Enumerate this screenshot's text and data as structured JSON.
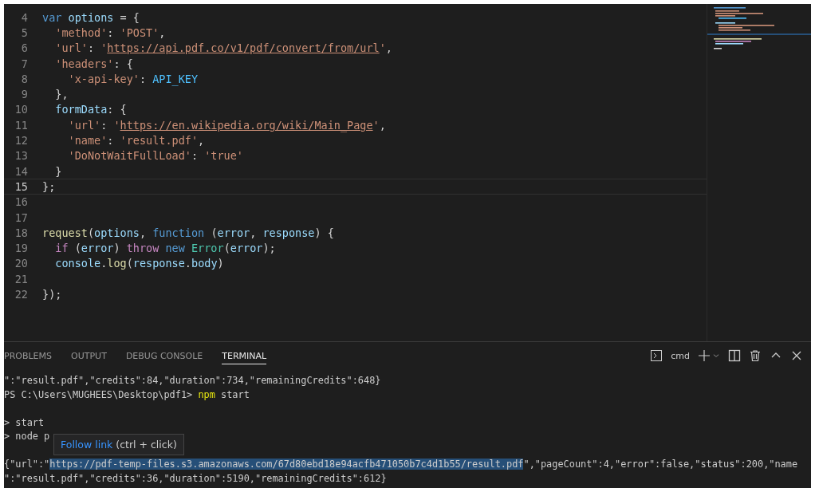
{
  "editor": {
    "lines": [
      {
        "number": "4",
        "current": false,
        "tokens": [
          {
            "text": "var",
            "kind": "keyword"
          },
          {
            "text": " options",
            "kind": "variable"
          },
          {
            "text": " = {",
            "kind": "plain"
          }
        ]
      },
      {
        "number": "5",
        "current": false,
        "tokens": [
          {
            "text": "  'method'",
            "kind": "string"
          },
          {
            "text": ": ",
            "kind": "plain"
          },
          {
            "text": "'POST'",
            "kind": "string"
          },
          {
            "text": ",",
            "kind": "plain"
          }
        ]
      },
      {
        "number": "6",
        "current": false,
        "tokens": [
          {
            "text": "  'url'",
            "kind": "string"
          },
          {
            "text": ": ",
            "kind": "plain"
          },
          {
            "text": "'",
            "kind": "string"
          },
          {
            "text": "https://api.pdf.co/v1/pdf/convert/from/url",
            "kind": "link"
          },
          {
            "text": "'",
            "kind": "string"
          },
          {
            "text": ",",
            "kind": "plain"
          }
        ]
      },
      {
        "number": "7",
        "current": false,
        "tokens": [
          {
            "text": "  'headers'",
            "kind": "string"
          },
          {
            "text": ": {",
            "kind": "plain"
          }
        ]
      },
      {
        "number": "8",
        "current": false,
        "tokens": [
          {
            "text": "    'x-api-key'",
            "kind": "string"
          },
          {
            "text": ": ",
            "kind": "plain"
          },
          {
            "text": "API_KEY",
            "kind": "constant"
          }
        ]
      },
      {
        "number": "9",
        "current": false,
        "tokens": [
          {
            "text": "  },",
            "kind": "plain"
          }
        ]
      },
      {
        "number": "10",
        "current": false,
        "tokens": [
          {
            "text": "  formData",
            "kind": "variable"
          },
          {
            "text": ": {",
            "kind": "plain"
          }
        ]
      },
      {
        "number": "11",
        "current": false,
        "tokens": [
          {
            "text": "    'url'",
            "kind": "string"
          },
          {
            "text": ": ",
            "kind": "plain"
          },
          {
            "text": "'",
            "kind": "string"
          },
          {
            "text": "https://en.wikipedia.org/wiki/Main_Page",
            "kind": "link"
          },
          {
            "text": "'",
            "kind": "string"
          },
          {
            "text": ",",
            "kind": "plain"
          }
        ]
      },
      {
        "number": "12",
        "current": false,
        "tokens": [
          {
            "text": "    'name'",
            "kind": "string"
          },
          {
            "text": ": ",
            "kind": "plain"
          },
          {
            "text": "'result.pdf'",
            "kind": "string"
          },
          {
            "text": ",",
            "kind": "plain"
          }
        ]
      },
      {
        "number": "13",
        "current": false,
        "tokens": [
          {
            "text": "    'DoNotWaitFullLoad'",
            "kind": "string"
          },
          {
            "text": ": ",
            "kind": "plain"
          },
          {
            "text": "'true'",
            "kind": "string"
          }
        ]
      },
      {
        "number": "14",
        "current": false,
        "tokens": [
          {
            "text": "  }",
            "kind": "plain"
          }
        ]
      },
      {
        "number": "15",
        "current": true,
        "tokens": [
          {
            "text": "};",
            "kind": "plain"
          }
        ]
      },
      {
        "number": "16",
        "current": false
      },
      {
        "number": "17",
        "current": false
      },
      {
        "number": "18",
        "current": false,
        "tokens": [
          {
            "text": "request",
            "kind": "function"
          },
          {
            "text": "(",
            "kind": "plain"
          },
          {
            "text": "options",
            "kind": "variable"
          },
          {
            "text": ", ",
            "kind": "plain"
          },
          {
            "text": "function",
            "kind": "keyword"
          },
          {
            "text": " (",
            "kind": "plain"
          },
          {
            "text": "error",
            "kind": "variable"
          },
          {
            "text": ", ",
            "kind": "plain"
          },
          {
            "text": "response",
            "kind": "variable"
          },
          {
            "text": ") {",
            "kind": "plain"
          }
        ]
      },
      {
        "number": "19",
        "current": false,
        "tokens": [
          {
            "text": "  if",
            "kind": "control"
          },
          {
            "text": " (",
            "kind": "plain"
          },
          {
            "text": "error",
            "kind": "variable"
          },
          {
            "text": ") ",
            "kind": "plain"
          },
          {
            "text": "throw",
            "kind": "control"
          },
          {
            "text": " new",
            "kind": "keyword"
          },
          {
            "text": " Error",
            "kind": "class"
          },
          {
            "text": "(",
            "kind": "plain"
          },
          {
            "text": "error",
            "kind": "variable"
          },
          {
            "text": ");",
            "kind": "plain"
          }
        ]
      },
      {
        "number": "20",
        "current": false,
        "tokens": [
          {
            "text": "  console",
            "kind": "variable"
          },
          {
            "text": ".",
            "kind": "plain"
          },
          {
            "text": "log",
            "kind": "function"
          },
          {
            "text": "(",
            "kind": "plain"
          },
          {
            "text": "response",
            "kind": "variable"
          },
          {
            "text": ".",
            "kind": "plain"
          },
          {
            "text": "body",
            "kind": "variable"
          },
          {
            "text": ")",
            "kind": "plain"
          }
        ]
      },
      {
        "number": "21",
        "current": false
      },
      {
        "number": "22",
        "current": false,
        "tokens": [
          {
            "text": "});",
            "kind": "plain"
          }
        ]
      }
    ]
  },
  "panel": {
    "tabs": [
      {
        "label": "PROBLEMS",
        "selected": false
      },
      {
        "label": "OUTPUT",
        "selected": false
      },
      {
        "label": "DEBUG CONSOLE",
        "selected": false
      },
      {
        "label": "TERMINAL",
        "selected": true
      }
    ],
    "shell": "cmd",
    "terminal": [
      {
        "kind": "output",
        "segments": [
          {
            "text": "\":\"result.pdf\",\"credits\":84,\"duration\":734,\"remainingCredits\":648}",
            "kind": "plain"
          }
        ]
      },
      {
        "kind": "output",
        "segments": [
          {
            "text": "PS C:\\Users\\MUGHEES\\Desktop\\pdf1> ",
            "kind": "plain"
          },
          {
            "text": "npm",
            "kind": "command"
          },
          {
            "text": " start",
            "kind": "plain"
          }
        ]
      },
      {
        "kind": "blank"
      },
      {
        "kind": "output",
        "segments": [
          {
            "text": "> start",
            "kind": "plain"
          }
        ]
      },
      {
        "kind": "output",
        "segments": [
          {
            "text": "> node p",
            "kind": "plain"
          }
        ]
      },
      {
        "kind": "blank"
      },
      {
        "kind": "output",
        "segments": [
          {
            "text": "{\"url\":\"",
            "kind": "plain"
          },
          {
            "text": "https://pdf-temp-files.s3.amazonaws.com/67d80ebd18e94acfb471050b7c4d1b55/result.pdf",
            "kind": "link"
          },
          {
            "text": "\",\"pageCount\":4,\"error\":false,\"status\":200,\"name",
            "kind": "plain"
          }
        ]
      },
      {
        "kind": "output",
        "segments": [
          {
            "text": "\":\"result.pdf\",\"credits\":36,\"duration\":5190,\"remainingCredits\":612}",
            "kind": "plain"
          }
        ]
      }
    ],
    "tooltip": {
      "link": "Follow link",
      "hint": "(ctrl + click)"
    }
  }
}
